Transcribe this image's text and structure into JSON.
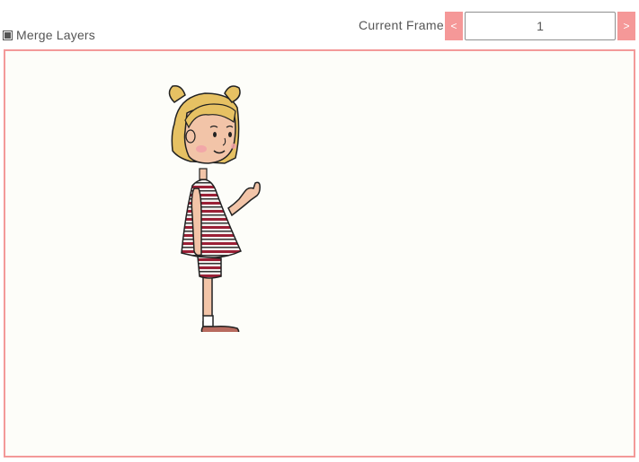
{
  "merge_layers": {
    "label": "Merge Layers",
    "checked": true
  },
  "frame": {
    "label": "Current Frame",
    "prev_label": "<",
    "next_label": ">",
    "value": "1"
  },
  "colors": {
    "accent": "#f59898",
    "canvas_border": "#f39999",
    "canvas_bg": "#fdfdf9"
  }
}
